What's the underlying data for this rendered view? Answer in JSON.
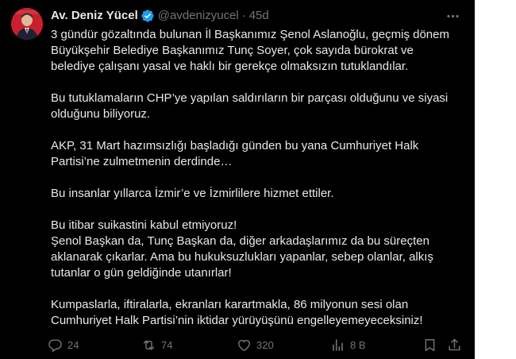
{
  "author": {
    "display_name": "Av. Deniz Yücel",
    "handle": "@avdenizyucel",
    "separator": "·",
    "time_ago": "45d",
    "verified_icon": "verified-badge-icon",
    "avatar_icon": "profile-avatar"
  },
  "tweet": {
    "paragraphs": [
      "3 gündür gözaltında bulunan İl Başkanımız Şenol Aslanoğlu, geçmiş dönem Büyükşehir Belediye Başkanımız Tunç Soyer, çok sayıda bürokrat ve belediye çalışanı yasal ve haklı bir gerekçe olmaksızın tutuklandılar.",
      "Bu tutuklamaların CHP’ye yapılan saldırıların bir parçası olduğunu ve siyasi olduğunu biliyoruz.",
      "AKP, 31 Mart hazımsızlığı başladığı günden bu yana Cumhuriyet Halk Partisi’ne zulmetmenin derdinde…",
      "Bu insanlar yıllarca İzmir’e ve İzmirlilere hizmet ettiler.",
      "Bu itibar suikastini kabul etmiyoruz!\nŞenol Başkan da, Tunç Başkan da, diğer arkadaşlarımız da bu süreçten aklanarak çıkarlar. Ama bu hukuksuzlukları yapanlar, sebep olanlar, alkış tutanlar o gün geldiğinde utanırlar!",
      "Kumpaslarla, iftiralarla, ekranları karartmakla, 86 milyonun sesi olan Cumhuriyet Halk Partisi’nin iktidar yürüyüşünü engelleyemeyeceksiniz!"
    ]
  },
  "actions": {
    "replies": "24",
    "reposts": "74",
    "likes": "320",
    "views": "8 B"
  },
  "colors": {
    "background": "#000000",
    "text": "#e7e9ea",
    "muted": "#71767b",
    "verified": "#1d9bf0"
  }
}
